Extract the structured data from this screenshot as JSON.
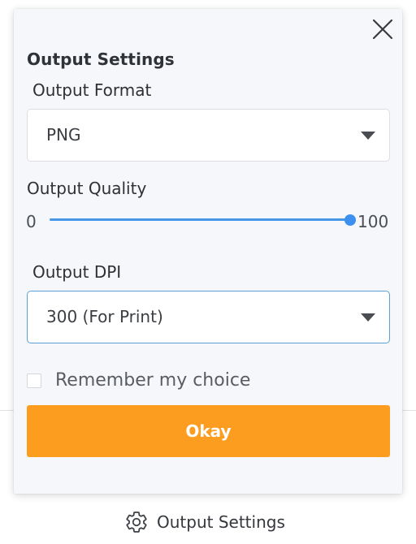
{
  "dialog": {
    "title": "Output Settings",
    "close_icon": "close-icon",
    "format": {
      "label": "Output Format",
      "selected": "PNG",
      "icon": "chevron-down-icon"
    },
    "quality": {
      "label": "Output Quality",
      "min_label": "0",
      "max_label": "100",
      "value": 100
    },
    "dpi": {
      "label": "Output DPI",
      "selected": "300 (For Print)",
      "icon": "chevron-down-icon"
    },
    "remember": {
      "label": "Remember my choice",
      "checked": false
    },
    "okay_label": "Okay"
  },
  "trigger": {
    "label": "Output Settings",
    "icon": "gear-icon"
  },
  "colors": {
    "accent": "#fd9d20",
    "slider": "#3d8ff0",
    "focus_border": "#5aa0d6"
  }
}
